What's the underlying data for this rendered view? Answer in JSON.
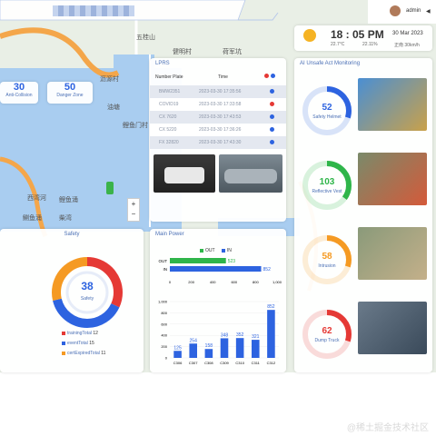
{
  "header": {
    "user": "admin",
    "time": "18 : 05 PM",
    "date": "30 Mar 2023",
    "temp": "22.7°C",
    "humidity": "22.11%",
    "wind": "正南 30km/h"
  },
  "map": {
    "labels": [
      "五桂山",
      "健明村",
      "荷军坑",
      "沥源村",
      "油塘",
      "鲤鱼门村",
      "西湾河",
      "鲤鱼涌",
      "鰂鱼涌",
      "柴湾"
    ],
    "zoom_plus": "+",
    "zoom_minus": "−"
  },
  "stats": [
    {
      "value": "30",
      "label": "Anti-Collision"
    },
    {
      "value": "50",
      "label": "Danger Zone"
    }
  ],
  "lprs": {
    "title": "LPRS",
    "headers": [
      "Number Plate",
      "Time"
    ],
    "rows": [
      {
        "plate": "BMW2351",
        "time": "2023-03-30 17:35:56",
        "color": "#2d63e0"
      },
      {
        "plate": "COVID19",
        "time": "2023-03-30 17:33:58",
        "color": "#e53935"
      },
      {
        "plate": "CX 7620",
        "time": "2023-03-30 17:43:53",
        "color": "#2d63e0"
      },
      {
        "plate": "CX 5220",
        "time": "2023-03-30 17:36:26",
        "color": "#2d63e0"
      },
      {
        "plate": "FX 32820",
        "time": "2023-03-30 17:43:30",
        "color": "#2d63e0"
      }
    ]
  },
  "ai": {
    "title": "AI Unsafe Act Monitoring",
    "items": [
      {
        "value": "52",
        "label": "Safety Helmet",
        "color": "#2d63e0",
        "pct": 0.3
      },
      {
        "value": "103",
        "label": "Reflective Vest",
        "color": "#2fb54a",
        "pct": 0.35
      },
      {
        "value": "58",
        "label": "Intrusion",
        "color": "#f59a23",
        "pct": 0.3
      },
      {
        "value": "62",
        "label": "Dump Truck",
        "color": "#e53935",
        "pct": 0.3
      }
    ]
  },
  "safety": {
    "title": "Safety",
    "center_value": "38",
    "center_label": "Safety",
    "legend": [
      {
        "label": "trainingTotal",
        "value": "12",
        "color": "#e53935"
      },
      {
        "label": "eventTotal",
        "value": "15",
        "color": "#2d63e0"
      },
      {
        "label": "certExpiredTotal",
        "value": "11",
        "color": "#f59a23"
      }
    ]
  },
  "power": {
    "title": "Main Power",
    "legend_out": "OUT",
    "legend_in": "IN",
    "out_value": "523",
    "in_value": "852"
  },
  "chart_data": {
    "type": "bar",
    "categories": [
      "C306",
      "C307",
      "C308",
      "C309",
      "C310",
      "C311",
      "C312"
    ],
    "values": [
      125,
      254,
      158,
      348,
      352,
      321,
      852
    ],
    "ylim": [
      0,
      1000
    ],
    "yticks": [
      "1,000",
      "800",
      "600",
      "400",
      "200",
      "0"
    ]
  },
  "hbar": {
    "type": "bar",
    "categories": [
      "OUT",
      "IN"
    ],
    "values": [
      523,
      852
    ],
    "xticks": [
      "0",
      "200",
      "400",
      "600",
      "800",
      "1,000"
    ]
  },
  "watermark": "@稀土掘金技术社区"
}
